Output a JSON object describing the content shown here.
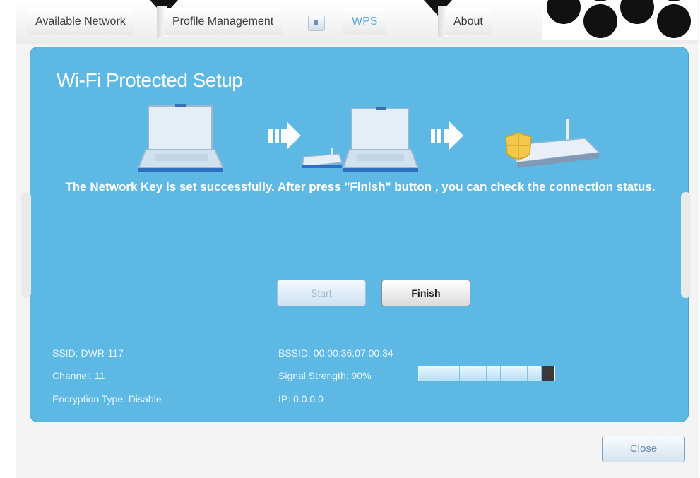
{
  "tabs": [
    {
      "label": "Available Network",
      "active": false
    },
    {
      "label": "Profile Management",
      "active": false
    },
    {
      "label": "WPS",
      "active": true
    },
    {
      "label": "About",
      "active": false
    }
  ],
  "panel": {
    "title": "Wi-Fi Protected Setup",
    "message": "The Network Key is set successfully. After press \"Finish\" button , you can check the connection status."
  },
  "buttons": {
    "start": "Start",
    "finish": "Finish",
    "close": "Close"
  },
  "info": {
    "ssid": "SSID: DWR-117",
    "channel": "Channel: 11",
    "encryption": "Encryption Type: Disable",
    "bssid": "BSSID: 00:00:36:07:00:34",
    "signal": "Signal Strength: 90%",
    "ip": "IP: 0.0.0.0"
  },
  "signal_strength_percent": 90,
  "icons": [
    "laptop-icon",
    "arrow-right-icon",
    "wps-dongle-icon",
    "laptop-icon",
    "arrow-right-icon",
    "secure-router-icon"
  ],
  "colors": {
    "panel": "#5db8e4",
    "active_tab": "#5ba8dc"
  }
}
